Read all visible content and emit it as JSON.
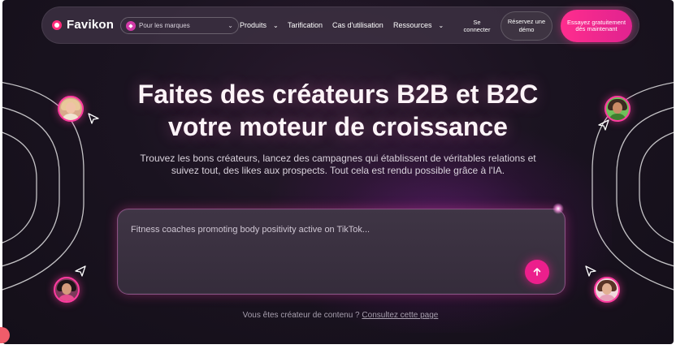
{
  "brand": {
    "name": "Favikon"
  },
  "nav": {
    "brand_selector": "Pour les marques",
    "items": [
      {
        "label": "Produits",
        "has_dropdown": true
      },
      {
        "label": "Tarification",
        "has_dropdown": false
      },
      {
        "label": "Cas d'utilisation",
        "has_dropdown": false
      },
      {
        "label": "Ressources",
        "has_dropdown": true
      }
    ],
    "login": "Se connecter",
    "demo_button": "Réservez une démo",
    "cta_button": "Essayez gratuitement dès maintenant"
  },
  "hero": {
    "title_line1": "Faites des créateurs B2B et B2C",
    "title_line2": "votre moteur de croissance",
    "subtitle": "Trouvez les bons créateurs, lancez des campagnes qui établissent de véritables relations et suivez tout, des likes aux prospects. Tout cela est rendu possible grâce à l'IA."
  },
  "search": {
    "placeholder": "Fitness coaches promoting body positivity active on TikTok..."
  },
  "footer": {
    "text": "Vous êtes créateur de contenu ?",
    "link": "Consultez cette page"
  },
  "colors": {
    "accent": "#ec1f8c",
    "background": "#1a1320",
    "nav_bg": "#3c3042"
  },
  "icons": {
    "send": "arrow-up-icon",
    "brand_selector": "diamond-icon",
    "cursor": "cursor-arrow-icon"
  }
}
